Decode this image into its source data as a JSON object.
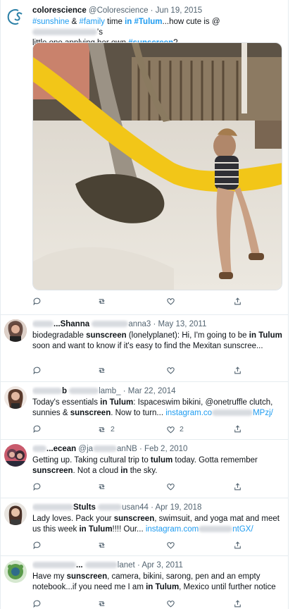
{
  "tweets": [
    {
      "name": "colorescience",
      "handle": "@Colorescience",
      "date": "· Jun 19, 2015",
      "text_parts": {
        "t1": "#sunshine",
        "t2": " & ",
        "t3": "#family",
        "t4": " time ",
        "t5": "in #Tulum",
        "t6": "...how cute is @",
        "t7": "'s",
        "t8": "little one applying her own ",
        "t9": "#sunscreen",
        "t10": "?"
      },
      "has_photo": true
    },
    {
      "name_part": "...Shanna",
      "handle_part": "anna3",
      "date": "· May 13, 2011",
      "text_parts": {
        "t1": "biodegradable ",
        "t2": "sunscreen",
        "t3": " (lonelyplanet): Hi, I'm going to be ",
        "t4": "in Tulum",
        "t5": " soon and want to know if it's easy to find the Mexitan sunscree..."
      }
    },
    {
      "name_part": "b",
      "handle_part": "lamb_",
      "date": "· Mar 22, 2014",
      "text_parts": {
        "t1": "Today's essentials ",
        "t2": "in Tulum",
        "t3": ": Ispaceswim bikini, @onetruffle clutch, sunnies & ",
        "t4": "sunscreen",
        "t5": ". Now to turn... ",
        "t6": "instagram.co",
        "t7": "MPzj/"
      },
      "retweets": "2",
      "likes": "2"
    },
    {
      "name_part": "...ecean",
      "handle_part": "@ja",
      "handle_part2": "anNB",
      "date": "· Feb 2, 2010",
      "text_parts": {
        "t1": "Getting up. Taking cultural trip to ",
        "t2": "tulum",
        "t3": " today. Gotta remember ",
        "t4": "sunscreen",
        "t5": ". Not a cloud ",
        "t6": "in",
        "t7": " the sky."
      }
    },
    {
      "name_part": "Stults",
      "handle_part": "usan44",
      "date": "· Apr 19, 2018",
      "text_parts": {
        "t1": "Lady loves. Pack your ",
        "t2": "sunscreen",
        "t3": ", swimsuit, and yoga mat and meet us this week ",
        "t4": "in Tulum",
        "t5": "!!!! Our... ",
        "t6": "instagram.com",
        "t7": "ntGX/"
      }
    },
    {
      "name_part": "...",
      "handle_part": "lanet",
      "date": "· Apr 3, 2011",
      "text_parts": {
        "t1": "Have my ",
        "t2": "sunscreen",
        "t3": ", camera, bikini, sarong, pen and an empty notebook...if you need me I am ",
        "t4": "in Tulum",
        "t5": ", Mexico until further notice"
      }
    }
  ],
  "colors": {
    "accent": "#1d9bf0",
    "text": "#0f1419",
    "muted": "#536471",
    "brand": "#2a7fa6"
  }
}
